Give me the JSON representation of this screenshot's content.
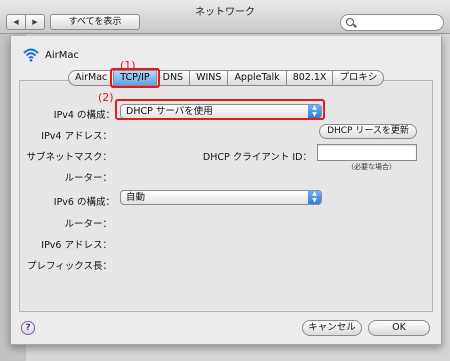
{
  "window": {
    "title": "ネットワーク",
    "show_all": "すべてを表示",
    "back_glyph": "◀",
    "forward_glyph": "▶"
  },
  "device": {
    "name": "AirMac",
    "icon": "wifi-icon"
  },
  "tabs": [
    "AirMac",
    "TCP/IP",
    "DNS",
    "WINS",
    "AppleTalk",
    "802.1X",
    "プロキシ"
  ],
  "active_tab": "TCP/IP",
  "annotations": {
    "tab": "(1)",
    "popup": "(2)"
  },
  "ipv4": {
    "config_label": "IPv4 の構成：",
    "config_value": "DHCP サーバを使用",
    "address_label": "IPv4 アドレス：",
    "subnet_label": "サブネットマスク：",
    "router_label": "ルーター：",
    "renew_button": "DHCP リースを更新",
    "client_id_label": "DHCP クライアント ID：",
    "client_id_value": "",
    "client_id_note": "（必要な場合）"
  },
  "ipv6": {
    "config_label": "IPv6 の構成：",
    "config_value": "自動",
    "router_label": "ルーター：",
    "address_label": "IPv6 アドレス：",
    "prefix_label": "プレフィックス長："
  },
  "footer": {
    "help": "?",
    "cancel": "キャンセル",
    "ok": "OK"
  },
  "colors": {
    "highlight": "#e21b23",
    "active_tab": "#5da3ea",
    "popup_arrows": "#2f7bd6"
  }
}
